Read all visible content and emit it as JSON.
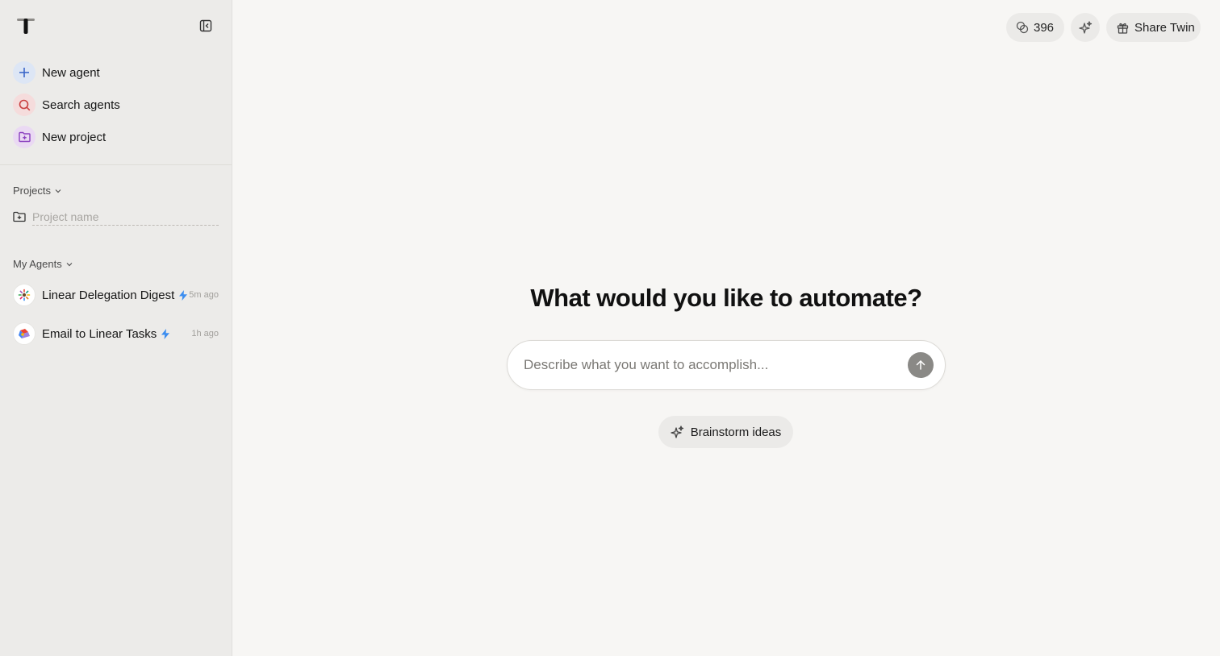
{
  "sidebar": {
    "nav": [
      {
        "label": "New agent",
        "icon": "plus-icon",
        "bg": "#dde6f5",
        "color": "#3b67c9"
      },
      {
        "label": "Search agents",
        "icon": "search-icon",
        "bg": "#f5dcdc",
        "color": "#c94040"
      },
      {
        "label": "New project",
        "icon": "folder-plus-icon",
        "bg": "#ead9f3",
        "color": "#8a3fbf"
      }
    ],
    "projects_heading": "Projects",
    "project_placeholder": "Project name",
    "agents_heading": "My Agents",
    "agents": [
      {
        "name": "Linear Delegation Digest",
        "time": "5m ago"
      },
      {
        "name": "Email to Linear Tasks",
        "time": "1h ago"
      }
    ]
  },
  "topbar": {
    "credits": "396",
    "share_label": "Share Twin"
  },
  "main": {
    "headline": "What would you like to automate?",
    "prompt_placeholder": "Describe what you want to accomplish...",
    "brainstorm_label": "Brainstorm ideas"
  },
  "colors": {
    "bolt": "#3b8df0",
    "sidebar_bg": "#ecebe9",
    "main_bg": "#f7f6f4"
  }
}
